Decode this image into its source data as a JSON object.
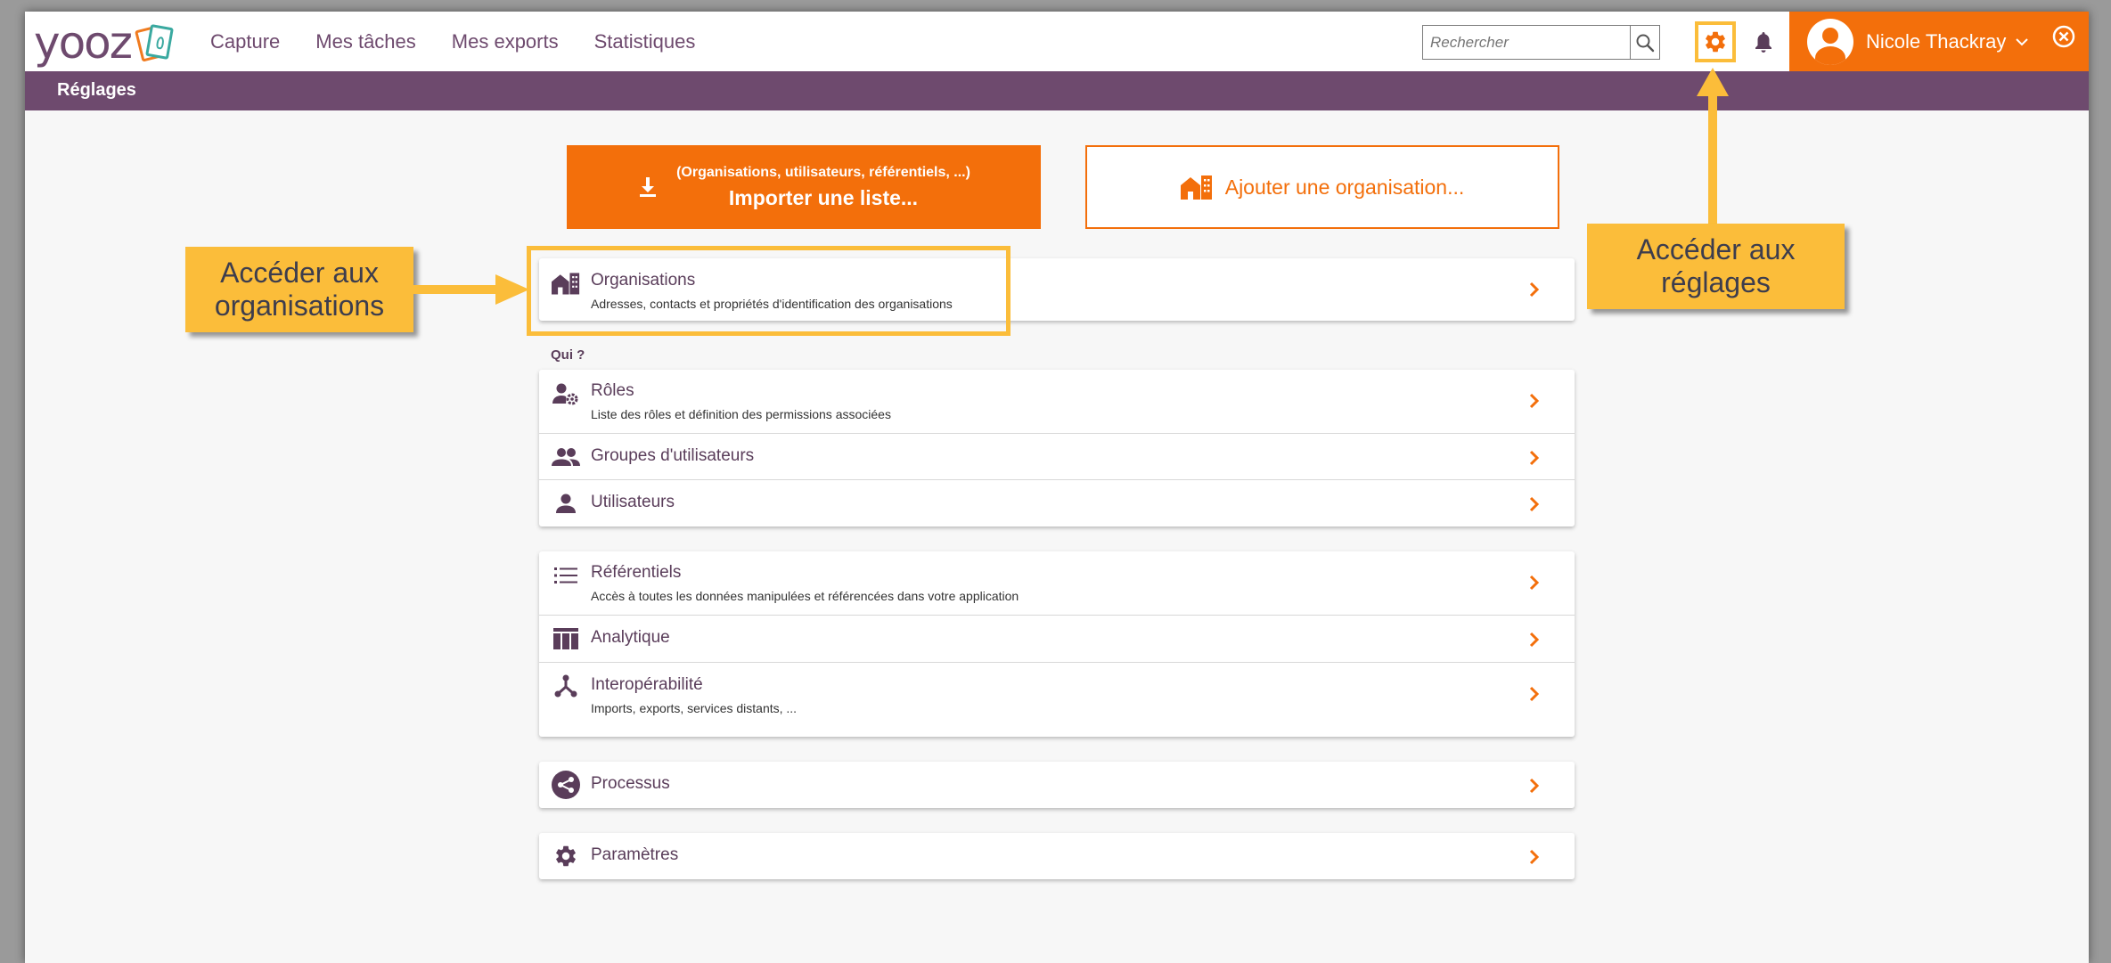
{
  "header": {
    "logo_text": "yooz",
    "nav": [
      "Capture",
      "Mes tâches",
      "Mes exports",
      "Statistiques"
    ],
    "search_placeholder": "Rechercher",
    "user_name": "Nicole Thackray"
  },
  "subheader": {
    "title": "Réglages"
  },
  "actions": {
    "import_small": "(Organisations, utilisateurs, référentiels, ...)",
    "import_big": "Importer une liste...",
    "add_org": "Ajouter une organisation..."
  },
  "organisations": {
    "title": "Organisations",
    "desc": "Adresses, contacts et propriétés d'identification des organisations"
  },
  "qui_label": "Qui ?",
  "qui": [
    {
      "title": "Rôles",
      "desc": "Liste des rôles et définition des permissions associées"
    },
    {
      "title": "Groupes d'utilisateurs"
    },
    {
      "title": "Utilisateurs"
    }
  ],
  "data_section": [
    {
      "title": "Référentiels",
      "desc": "Accès à toutes les données manipulées et référencées dans votre application"
    },
    {
      "title": "Analytique"
    },
    {
      "title": "Interopérabilité",
      "desc": "Imports, exports, services distants, ..."
    }
  ],
  "processus": {
    "title": "Processus"
  },
  "parametres": {
    "title": "Paramètres"
  },
  "annotations": {
    "orgs_line1": "Accéder aux",
    "orgs_line2": "organisations",
    "settings_line1": "Accéder aux",
    "settings_line2": "réglages"
  },
  "colors": {
    "brand_purple": "#6e4a6e",
    "brand_orange": "#f36f0b",
    "annotation_yellow": "#fbbd3a"
  }
}
